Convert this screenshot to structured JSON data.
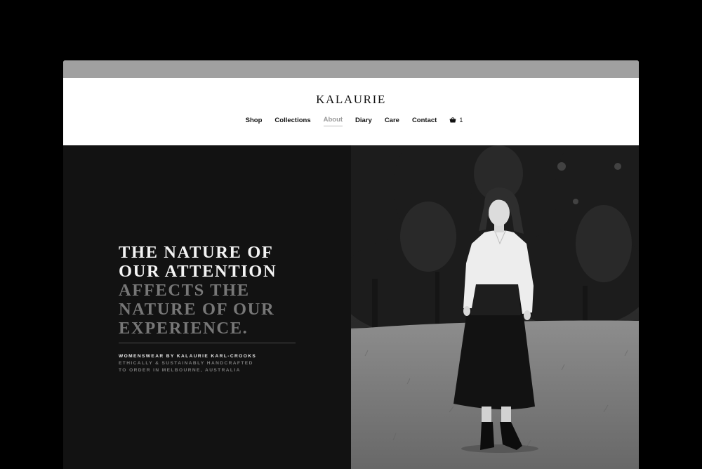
{
  "site": {
    "logo": "KALAURIE"
  },
  "nav": {
    "items": [
      {
        "label": "Shop"
      },
      {
        "label": "Collections"
      },
      {
        "label": "About",
        "active": true
      },
      {
        "label": "Diary"
      },
      {
        "label": "Care"
      },
      {
        "label": "Contact"
      }
    ],
    "cart_count": "1",
    "cart_icon": "basket-icon"
  },
  "hero": {
    "headline_bright": [
      "THE NATURE OF",
      "OUR ATTENTION"
    ],
    "headline_dim": [
      "AFFECTS THE",
      "NATURE OF OUR",
      "EXPERIENCE."
    ],
    "meta_bright": "WOMENSWEAR BY KALAURIE KARL-CROOKS",
    "meta_dim": [
      "ETHICALLY & SUSTAINABLY HANDCRAFTED",
      "TO ORDER IN MELBOURNE, AUSTRALIA"
    ]
  },
  "colors": {
    "page_bg": "#000000",
    "browser_bar": "#a0a0a0",
    "hero_left_bg": "#121212",
    "nav_active": "#999999"
  }
}
